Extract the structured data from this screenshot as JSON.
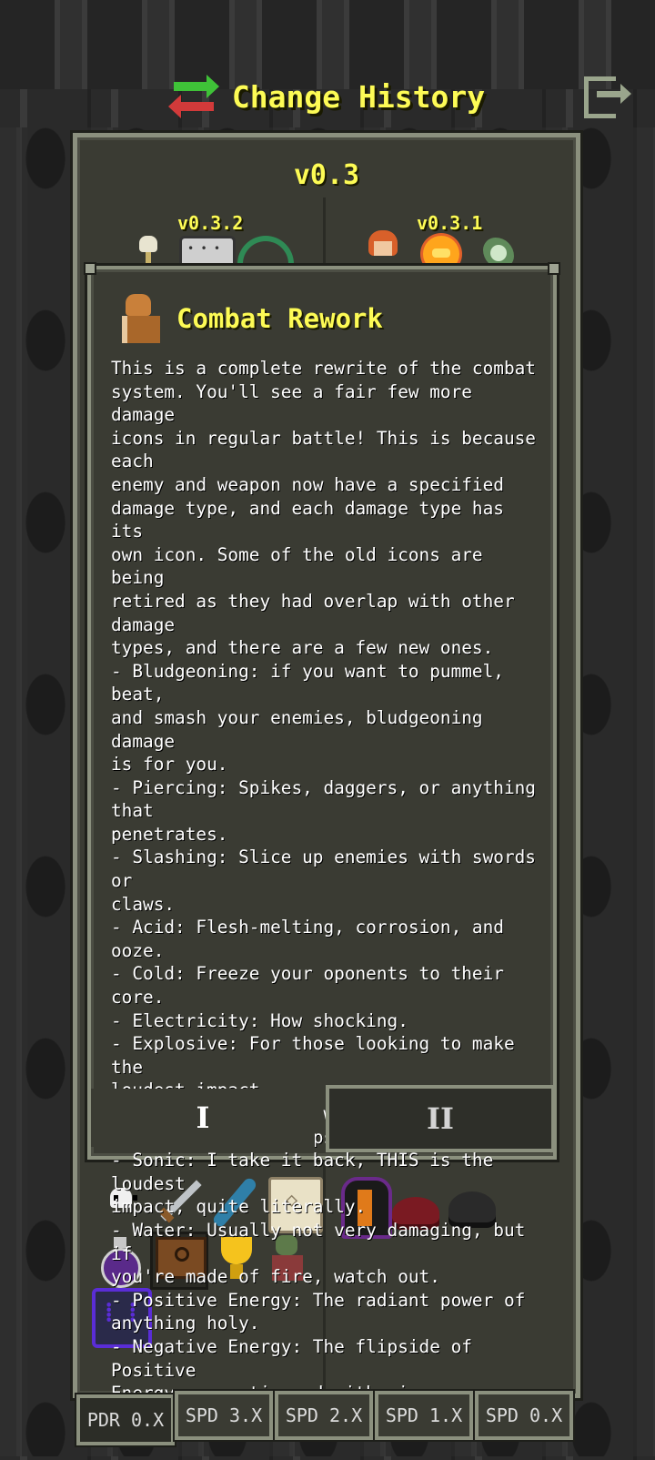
{
  "header": {
    "title": "Change History",
    "icons": [
      "swap-arrows-icon",
      "exit-icon"
    ]
  },
  "panel": {
    "version": "v0.3",
    "sub_versions": [
      "v0.3.2",
      "v0.3.1"
    ]
  },
  "dialog": {
    "title": "Combat Rework",
    "icon": "monk-sprite-icon",
    "body": "This is a complete rewrite of the combat\nsystem. You'll see a fair few more damage\nicons in regular battle! This is because each\nenemy and weapon now have a specified\ndamage type, and each damage type has its\nown icon. Some of the old icons are being\nretired as they had overlap with other damage\ntypes, and there are a few new ones.\n- Bludgeoning: if you want to pummel, beat,\nand smash your enemies, bludgeoning damage\nis for you.\n- Piercing: Spikes, daggers, or anything that\npenetrates.\n- Slashing: Slice up enemies with swords or\nclaws.\n- Acid: Flesh-melting, corrosion, and ooze.\n- Cold: Freeze your oponents to their core.\n- Electricity: How shocking.\n- Explosive: For those looking to make the\nloudest impact.\n- Fire: We all know what fire is.\n- Poison: Toxic traps and coated thorns.\n- Sonic: I take it back, THIS is the loudest\nimpact, quite literally.\n- Water: Usually not very damaging, but if\nyou're made of fire, watch out.\n- Positive Energy: The radiant power of\nanything holy.\n- Negative Energy: The flipside of Positive\nEnergy, necrotic and withering.\n- Force: Pure magic.",
    "tabs": [
      "I",
      "II"
    ]
  },
  "bottom_tabs": [
    "PDR 0.X",
    "SPD 3.X",
    "SPD 2.X",
    "SPD 1.X",
    "SPD 0.X"
  ],
  "colors": {
    "title_yellow": "#fdfb55",
    "panel_bg": "#3a3b33",
    "panel_border": "#8b907e"
  }
}
